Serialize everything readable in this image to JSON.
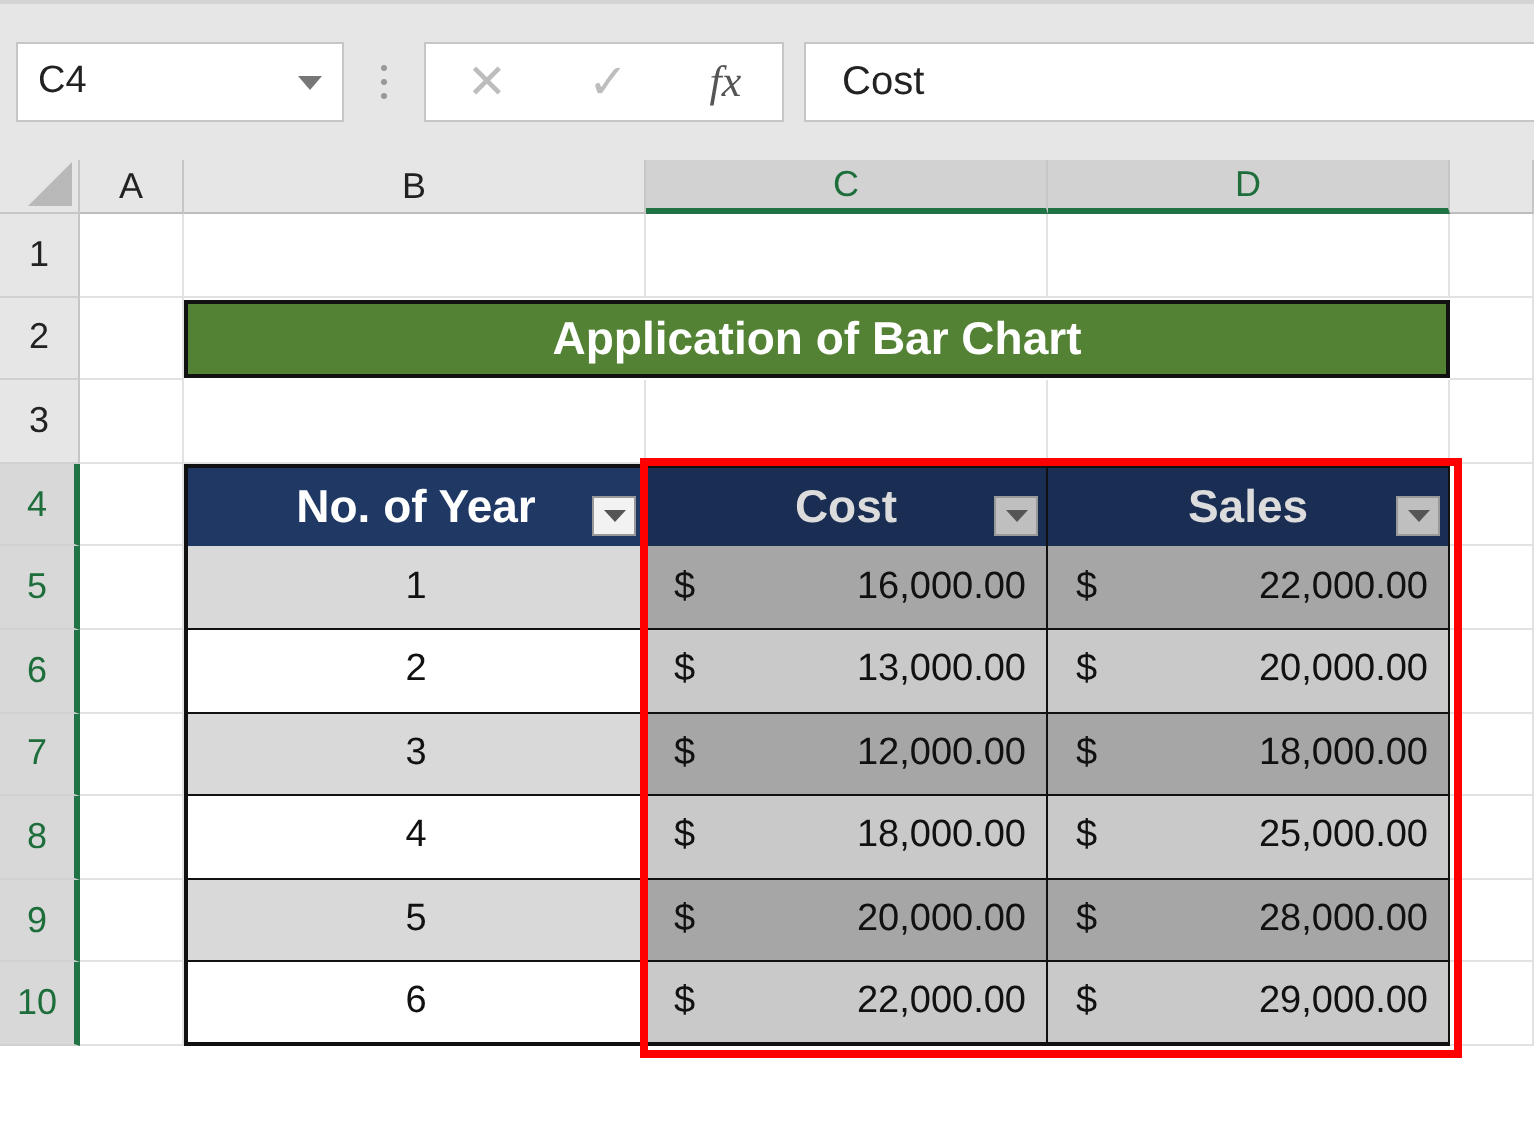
{
  "formula_bar": {
    "name_box": "C4",
    "cancel": "✕",
    "enter": "✓",
    "function": "fx",
    "formula": "Cost"
  },
  "sheet": {
    "columns": [
      {
        "label": "A",
        "selected": false
      },
      {
        "label": "B",
        "selected": false
      },
      {
        "label": "C",
        "selected": true
      },
      {
        "label": "D",
        "selected": true
      }
    ],
    "rows": [
      {
        "label": "1",
        "selected": false
      },
      {
        "label": "2",
        "selected": false
      },
      {
        "label": "3",
        "selected": false
      },
      {
        "label": "4",
        "selected": true
      },
      {
        "label": "5",
        "selected": true
      },
      {
        "label": "6",
        "selected": true
      },
      {
        "label": "7",
        "selected": true
      },
      {
        "label": "8",
        "selected": true
      },
      {
        "label": "9",
        "selected": true
      },
      {
        "label": "10",
        "selected": true
      }
    ],
    "banner": "Application of Bar Chart",
    "table": {
      "headers": [
        {
          "label": "No. of Year",
          "filter": true
        },
        {
          "label": "Cost",
          "filter": true
        },
        {
          "label": "Sales",
          "filter": true
        }
      ],
      "rows": [
        {
          "year": "1",
          "cost": {
            "symbol": "$",
            "amount": "16,000.00"
          },
          "sales": {
            "symbol": "$",
            "amount": "22,000.00"
          }
        },
        {
          "year": "2",
          "cost": {
            "symbol": "$",
            "amount": "13,000.00"
          },
          "sales": {
            "symbol": "$",
            "amount": "20,000.00"
          }
        },
        {
          "year": "3",
          "cost": {
            "symbol": "$",
            "amount": "12,000.00"
          },
          "sales": {
            "symbol": "$",
            "amount": "18,000.00"
          }
        },
        {
          "year": "4",
          "cost": {
            "symbol": "$",
            "amount": "18,000.00"
          },
          "sales": {
            "symbol": "$",
            "amount": "25,000.00"
          }
        },
        {
          "year": "5",
          "cost": {
            "symbol": "$",
            "amount": "20,000.00"
          },
          "sales": {
            "symbol": "$",
            "amount": "28,000.00"
          }
        },
        {
          "year": "6",
          "cost": {
            "symbol": "$",
            "amount": "22,000.00"
          },
          "sales": {
            "symbol": "$",
            "amount": "29,000.00"
          }
        }
      ]
    },
    "highlight_frame": true
  }
}
